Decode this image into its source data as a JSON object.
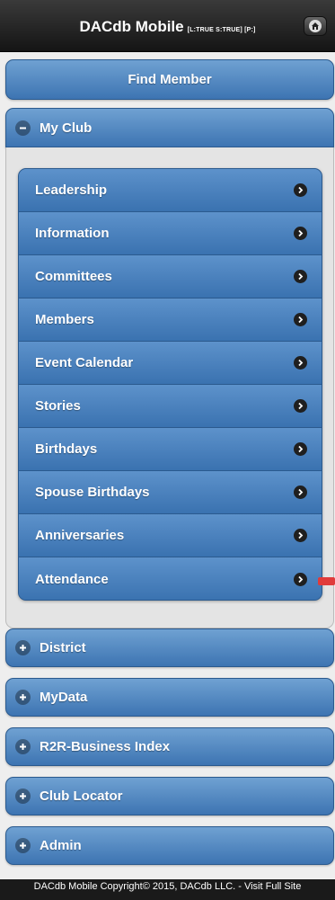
{
  "header": {
    "title": "DACdb Mobile",
    "tag": "[L:TRUE S:TRUE] [P:]",
    "home_icon": "home-icon"
  },
  "find_member": {
    "label": "Find Member"
  },
  "my_club": {
    "label": "My Club",
    "state": "expanded",
    "icon": "minus-icon",
    "items": [
      {
        "label": "Leadership"
      },
      {
        "label": "Information"
      },
      {
        "label": "Committees"
      },
      {
        "label": "Members"
      },
      {
        "label": "Event Calendar"
      },
      {
        "label": "Stories"
      },
      {
        "label": "Birthdays"
      },
      {
        "label": "Spouse Birthdays"
      },
      {
        "label": "Anniversaries"
      },
      {
        "label": "Attendance"
      }
    ]
  },
  "sections": [
    {
      "label": "District",
      "icon": "plus-icon"
    },
    {
      "label": "MyData",
      "icon": "plus-icon"
    },
    {
      "label": "R2R-Business Index",
      "icon": "plus-icon"
    },
    {
      "label": "Club Locator",
      "icon": "plus-icon"
    },
    {
      "label": "Admin",
      "icon": "plus-icon"
    }
  ],
  "footer": {
    "text": "DACdb Mobile Copyright© 2015, DACdb LLC. - Visit Full Site"
  },
  "colors": {
    "header_bg": "#1c1c1c",
    "button_blue": "#4a82c0",
    "accent_red": "#e03b3b"
  }
}
